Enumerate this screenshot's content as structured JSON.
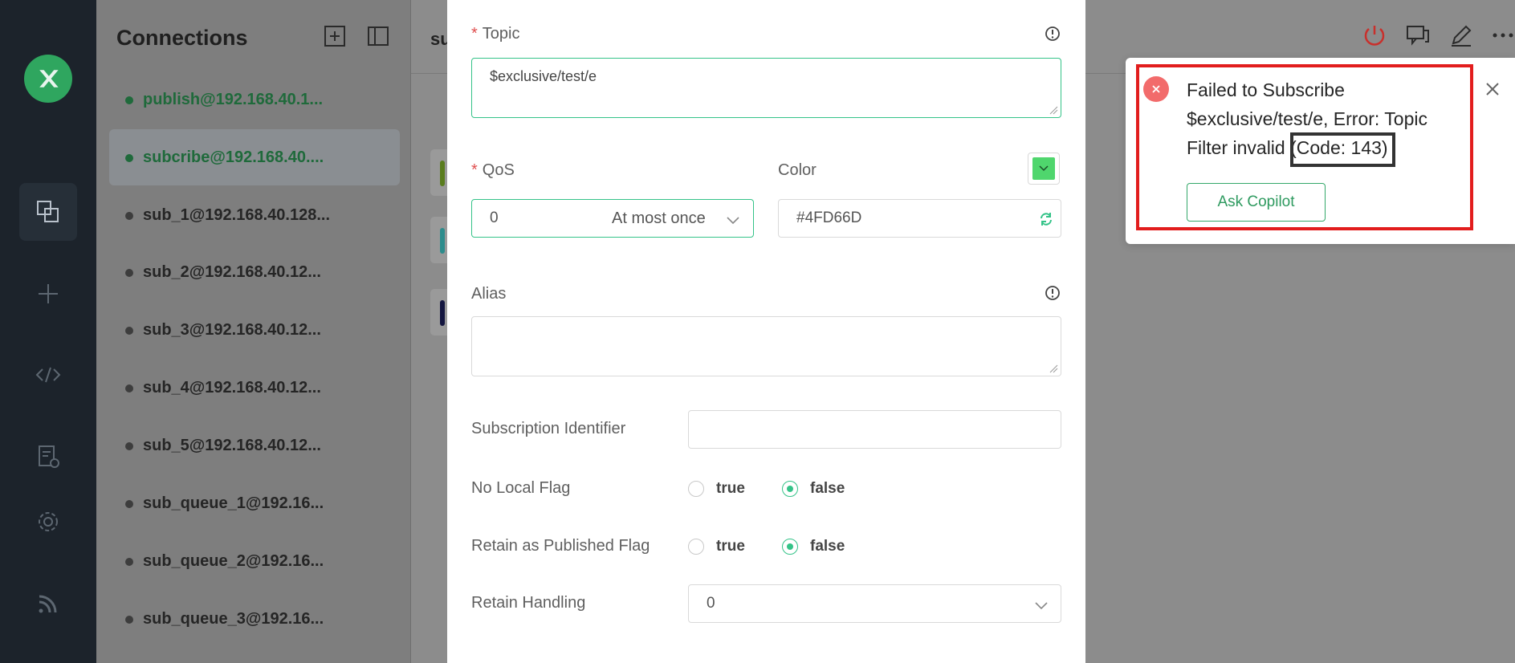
{
  "sidebar": {
    "icons": [
      "connections-icon",
      "new-connection-icon",
      "script-icon",
      "log-icon",
      "settings-icon",
      "subscriptions-feed-icon"
    ]
  },
  "connections": {
    "title": "Connections",
    "items": [
      {
        "label": "publish@192.168.40.1...",
        "status": "online"
      },
      {
        "label": "subcribe@192.168.40....",
        "status": "online"
      },
      {
        "label": "sub_1@192.168.40.128...",
        "status": "offline"
      },
      {
        "label": "sub_2@192.168.40.12...",
        "status": "offline"
      },
      {
        "label": "sub_3@192.168.40.12...",
        "status": "offline"
      },
      {
        "label": "sub_4@192.168.40.12...",
        "status": "offline"
      },
      {
        "label": "sub_5@192.168.40.12...",
        "status": "offline"
      },
      {
        "label": "sub_queue_1@192.16...",
        "status": "offline"
      },
      {
        "label": "sub_queue_2@192.16...",
        "status": "offline"
      },
      {
        "label": "sub_queue_3@192.16...",
        "status": "offline"
      }
    ]
  },
  "header": {
    "title": "su"
  },
  "form": {
    "topic_label": "Topic",
    "topic_value": "$exclusive/test/e",
    "qos_label": "QoS",
    "qos_value": "0",
    "qos_desc": "At most once",
    "color_label": "Color",
    "color_value": "#4FD66D",
    "alias_label": "Alias",
    "alias_value": "",
    "sub_id_label": "Subscription Identifier",
    "sub_id_value": "",
    "no_local_label": "No Local Flag",
    "retain_pub_label": "Retain as Published Flag",
    "retain_handling_label": "Retain Handling",
    "retain_handling_value": "0",
    "opt_true": "true",
    "opt_false": "false",
    "no_local_selected": "false",
    "retain_pub_selected": "false"
  },
  "notification": {
    "message_part1": "Failed to Subscribe $exclusive/test/e, Error: Topic Filter invalid",
    "message_code": "(Code: 143)",
    "ask_button": "Ask Copilot"
  },
  "colors": {
    "accent": "#34c388",
    "error": "#f26b6b",
    "highlight": "#e21d1d",
    "swatch": "#4FD66D"
  }
}
